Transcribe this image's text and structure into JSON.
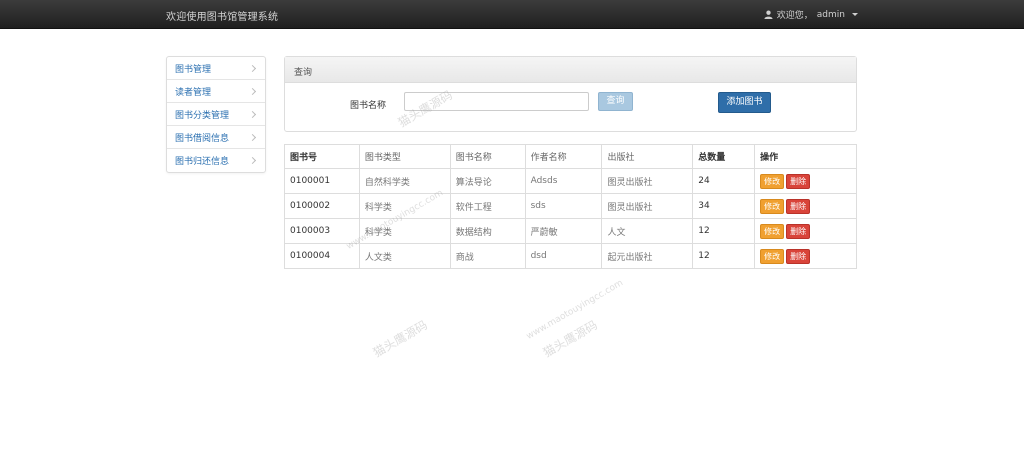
{
  "header": {
    "brand": "欢迎使用图书馆管理系统",
    "user_greeting": "欢迎您，",
    "username": "admin"
  },
  "sidebar": {
    "items": [
      {
        "label": "图书管理"
      },
      {
        "label": "读者管理"
      },
      {
        "label": "图书分类管理"
      },
      {
        "label": "图书借阅信息"
      },
      {
        "label": "图书归还信息"
      }
    ]
  },
  "query_panel": {
    "heading": "查询",
    "field_label": "图书名称",
    "input_value": "",
    "query_button": "查询",
    "add_button": "添加图书"
  },
  "table": {
    "columns": [
      "图书号",
      "图书类型",
      "图书名称",
      "作者名称",
      "出版社",
      "总数量",
      "操作"
    ],
    "rows": [
      {
        "id": "0100001",
        "type": "自然科学类",
        "name": "算法导论",
        "author": "Adsds",
        "publisher": "图灵出版社",
        "qty": "24"
      },
      {
        "id": "0100002",
        "type": "科学类",
        "name": "软件工程",
        "author": "sds",
        "publisher": "图灵出版社",
        "qty": "34"
      },
      {
        "id": "0100003",
        "type": "科学类",
        "name": "数据结构",
        "author": "严蔚敏",
        "publisher": "人文",
        "qty": "12"
      },
      {
        "id": "0100004",
        "type": "人文类",
        "name": "商战",
        "author": "dsd",
        "publisher": "起元出版社",
        "qty": "12"
      }
    ],
    "edit_label": "修改",
    "delete_label": "删除"
  },
  "watermark": {
    "text": "猫头鹰源码",
    "url": "www.maotouyingcc.com"
  },
  "colors": {
    "navbar": "#222222",
    "link": "#2a6fb0",
    "primary": "#2f6ea9",
    "warning": "#f0a030",
    "danger": "#d9443a"
  }
}
